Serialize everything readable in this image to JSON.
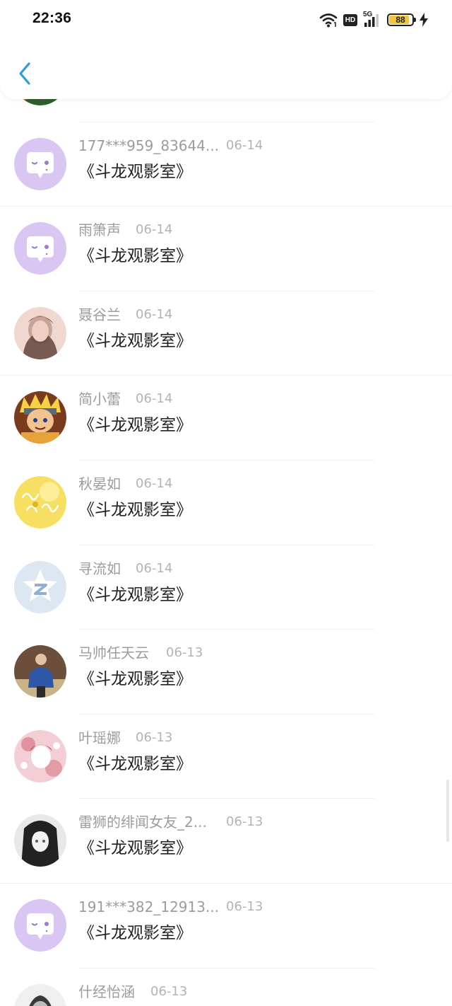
{
  "status_bar": {
    "time": "22:36",
    "hd_badge": "HD",
    "network": "5G",
    "battery_level": "88",
    "battery_fraction": 0.88,
    "battery_color": "#f3c53c",
    "icons": [
      "wifi-icon",
      "hd-icon",
      "signal-5g-icon",
      "battery-icon",
      "charging-icon"
    ]
  },
  "header": {
    "back_icon": "chevron-left-icon",
    "back_color": "#2d9cdb"
  },
  "list": {
    "items": [
      {
        "name": "",
        "date": "",
        "title": "",
        "avatar": "floral",
        "colors": [
          "#8b2e6b",
          "#d46a3e",
          "#2e5f2b"
        ]
      },
      {
        "name": "177***959_83644...",
        "date": "06-14",
        "title": "《斗龙观影室》",
        "avatar": "default-chat",
        "colors": [
          "#d9c6f2",
          "#ffffff",
          "#9a7cc9"
        ]
      },
      {
        "name": "雨箫声",
        "date": "06-14",
        "title": "《斗龙观影室》",
        "avatar": "default-chat",
        "colors": [
          "#d9c6f2",
          "#ffffff",
          "#9a7cc9"
        ]
      },
      {
        "name": "聂谷兰",
        "date": "06-14",
        "title": "《斗龙观影室》",
        "avatar": "portrait",
        "colors": [
          "#c9a39a",
          "#5a3d35",
          "#f0d8d0"
        ]
      },
      {
        "name": "简小蕾",
        "date": "06-14",
        "title": "《斗龙观影室》",
        "avatar": "anime-orange",
        "colors": [
          "#e7a23a",
          "#7a3a1c",
          "#f6d046"
        ]
      },
      {
        "name": "秋晏如",
        "date": "06-14",
        "title": "《斗龙观影室》",
        "avatar": "yellow-text",
        "colors": [
          "#f7df63",
          "#fff1a6",
          "#d8b81e"
        ]
      },
      {
        "name": "寻流如",
        "date": "06-14",
        "title": "《斗龙观影室》",
        "avatar": "qzone-star",
        "colors": [
          "#dde7f1",
          "#ffffff",
          "#8fb0d2"
        ]
      },
      {
        "name": "马帅任天云",
        "date": "06-13",
        "title": "《斗龙观影室》",
        "avatar": "person-photo",
        "colors": [
          "#6b4f3a",
          "#2f58a8",
          "#c9b48a"
        ]
      },
      {
        "name": "叶瑶娜",
        "date": "06-13",
        "title": "《斗龙观影室》",
        "avatar": "pink-anime",
        "colors": [
          "#f3cfd5",
          "#d9788a",
          "#ffffff"
        ]
      },
      {
        "name": "雷狮的绯闻女友_2...",
        "date": "06-13",
        "title": "《斗龙观影室》",
        "avatar": "bw-anime",
        "colors": [
          "#222222",
          "#e8e8e8",
          "#5a5a5a"
        ]
      },
      {
        "name": "191***382_12913...",
        "date": "06-13",
        "title": "《斗龙观影室》",
        "avatar": "default-chat",
        "colors": [
          "#d9c6f2",
          "#ffffff",
          "#9a7cc9"
        ]
      },
      {
        "name": "什经怡涵",
        "date": "06-13",
        "title": "",
        "avatar": "gray-portrait",
        "colors": [
          "#bdbdbd",
          "#3a3a3a",
          "#efefef"
        ]
      }
    ]
  }
}
